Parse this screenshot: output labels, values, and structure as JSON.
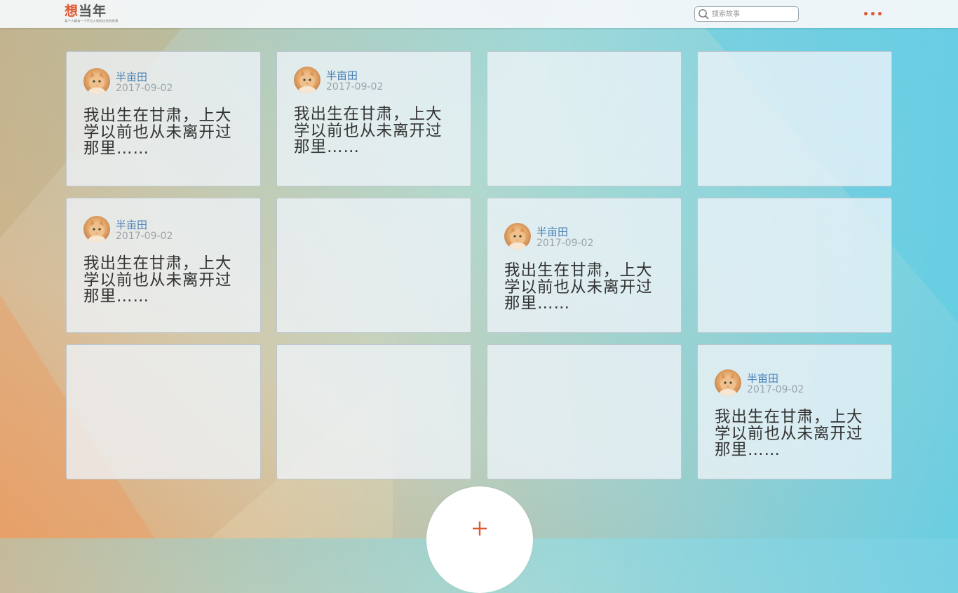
{
  "brand": {
    "name_first": "想",
    "name_rest": "当年",
    "tagline": "每个人都有一个不为人知的过去的故事"
  },
  "search": {
    "placeholder": "搜索故事"
  },
  "accent_color": "#e0572f",
  "link_color": "#4a7fb6",
  "cards": [
    {
      "author": "半亩田",
      "date": "2017-09-02",
      "excerpt": "我出生在甘肃，上大学以前也从未离开过那里……"
    },
    {
      "author": "半亩田",
      "date": "2017-09-02",
      "excerpt": "我出生在甘肃，上大学以前也从未离开过那里……"
    },
    {},
    {},
    {
      "author": "半亩田",
      "date": "2017-09-02",
      "excerpt": "我出生在甘肃，上大学以前也从未离开过那里……"
    },
    {},
    {
      "author": "半亩田",
      "date": "2017-09-02",
      "excerpt": "我出生在甘肃，上大学以前也从未离开过那里……"
    },
    {},
    {},
    {},
    {},
    {
      "author": "半亩田",
      "date": "2017-09-02",
      "excerpt": "我出生在甘肃，上大学以前也从未离开过那里……"
    }
  ],
  "icons": {
    "search": "search-icon",
    "more": "more-dots-icon",
    "add": "plus-icon"
  }
}
